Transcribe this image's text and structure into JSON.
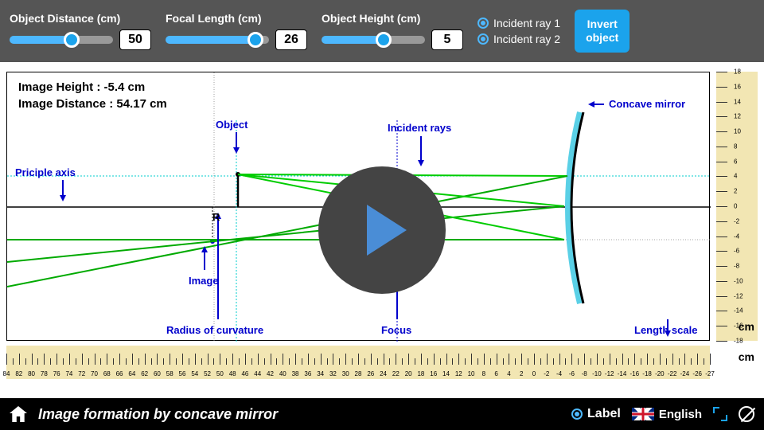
{
  "controls": {
    "object_distance": {
      "label": "Object Distance (cm)",
      "value": "50",
      "pct": 60
    },
    "focal_length": {
      "label": "Focal Length (cm)",
      "value": "26",
      "pct": 87
    },
    "object_height": {
      "label": "Object Height (cm)",
      "value": "5",
      "pct": 60
    }
  },
  "radios": {
    "r1": "Incident ray 1",
    "r2": "Incident ray 2"
  },
  "invert_btn": "Invert\nobject",
  "info": {
    "h": "Image Height : -5.4 cm",
    "d": "Image Distance : 54.17 cm"
  },
  "labels": {
    "object": "Object",
    "incident": "Incident rays",
    "mirror": "Concave mirror",
    "axis": "Priciple axis",
    "R": "R",
    "image": "Image",
    "radius": "Radius of curvature",
    "focus": "Focus",
    "length": "Length scale"
  },
  "cm": "cm",
  "bottom": {
    "title": "Image formation by concave mirror",
    "label": "Label",
    "lang": "English"
  },
  "hruler_vals": [
    84,
    82,
    80,
    78,
    76,
    74,
    72,
    70,
    68,
    66,
    64,
    62,
    60,
    58,
    56,
    54,
    52,
    50,
    48,
    46,
    44,
    42,
    40,
    38,
    36,
    34,
    32,
    30,
    28,
    26,
    24,
    22,
    20,
    18,
    16,
    14,
    12,
    10,
    8,
    6,
    4,
    2,
    0,
    -2,
    -4,
    -6,
    -8,
    -10,
    -12,
    -14,
    -16,
    -18,
    -20,
    -22,
    -24,
    -26,
    -27
  ],
  "vruler_vals": [
    18,
    16,
    14,
    12,
    10,
    8,
    6,
    4,
    2,
    0,
    -2,
    -4,
    -6,
    -8,
    -10,
    -12,
    -14,
    -16,
    -18
  ]
}
